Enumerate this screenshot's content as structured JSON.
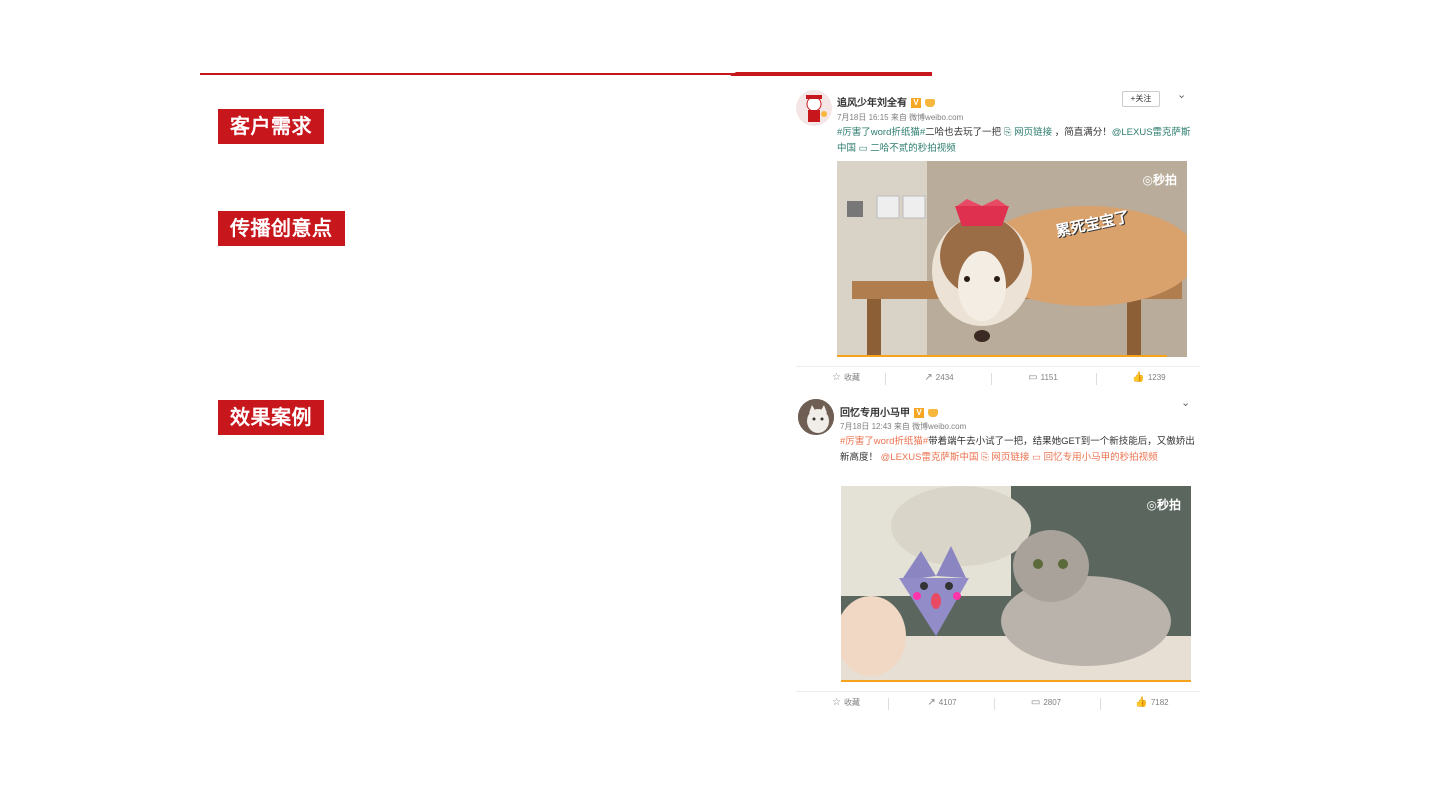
{
  "sections": {
    "needs": "客户需求",
    "idea": "传播创意点",
    "cases": "效果案例"
  },
  "posts": [
    {
      "username": "追风少年刘全有",
      "v_badge": "V",
      "follow": "+关注",
      "time": "7月18日 16:15",
      "source_prefix": "来自",
      "source": "微博weibo.com",
      "tag": "#厉害了word折纸猫#",
      "text1": "二哈也去玩了一把",
      "link1": "网页链接",
      "text2": "，简直满分！",
      "mention": "@LEXUS雷克萨斯中国",
      "video": "二哈不贰的秒拍视频",
      "image_caption": "累死宝宝了",
      "watermark": "秒拍",
      "actions": {
        "fav": "收藏",
        "share": "2434",
        "comment": "1151",
        "like": "1239"
      }
    },
    {
      "username": "回忆专用小马甲",
      "v_badge": "V",
      "time": "7月18日 12:43",
      "source_prefix": "来自",
      "source": "微博weibo.com",
      "tag": "#厉害了word折纸猫#",
      "text1": "带着端午去小试了一把，结果她GET到一个新技能后，又傲娇出新高度！",
      "mention": "@LEXUS雷克萨斯中国",
      "link1": "网页链接",
      "video": "回忆专用小马甲的秒拍视频",
      "watermark": "秒拍",
      "actions": {
        "fav": "收藏",
        "share": "4107",
        "comment": "2807",
        "like": "7182"
      }
    }
  ],
  "colors": {
    "accent": "#c8161d",
    "tag": "#eb7350",
    "link": "#4a7eb5",
    "progress": "#f7a21b"
  },
  "icons": [
    "star-icon",
    "share-icon",
    "comment-icon",
    "like-icon",
    "link-icon",
    "video-icon",
    "chevron-down-icon",
    "camera-icon"
  ]
}
